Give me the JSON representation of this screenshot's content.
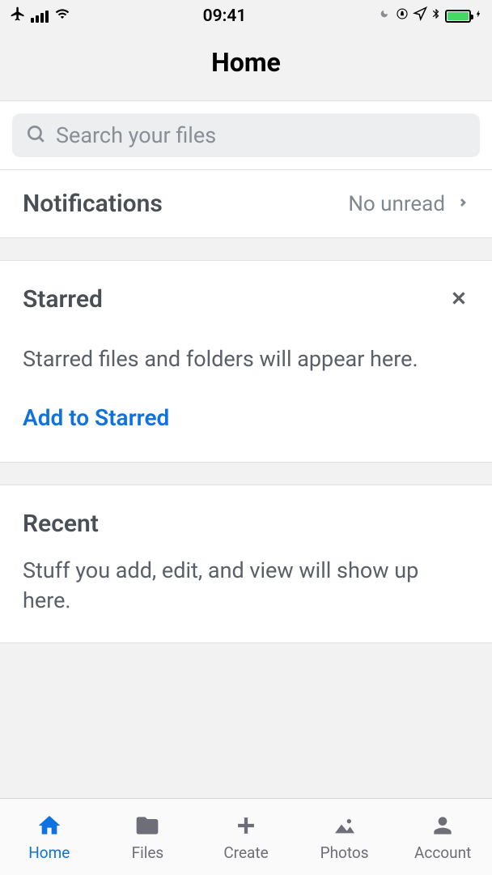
{
  "status_bar": {
    "time": "09:41"
  },
  "header": {
    "title": "Home"
  },
  "search": {
    "placeholder": "Search your files"
  },
  "notifications": {
    "label": "Notifications",
    "status": "No unread"
  },
  "starred": {
    "title": "Starred",
    "description": "Starred files and folders will appear here.",
    "action": "Add to Starred"
  },
  "recent": {
    "title": "Recent",
    "description": "Stuff you add, edit, and view will show up here."
  },
  "tabs": {
    "home": "Home",
    "files": "Files",
    "create": "Create",
    "photos": "Photos",
    "account": "Account"
  }
}
